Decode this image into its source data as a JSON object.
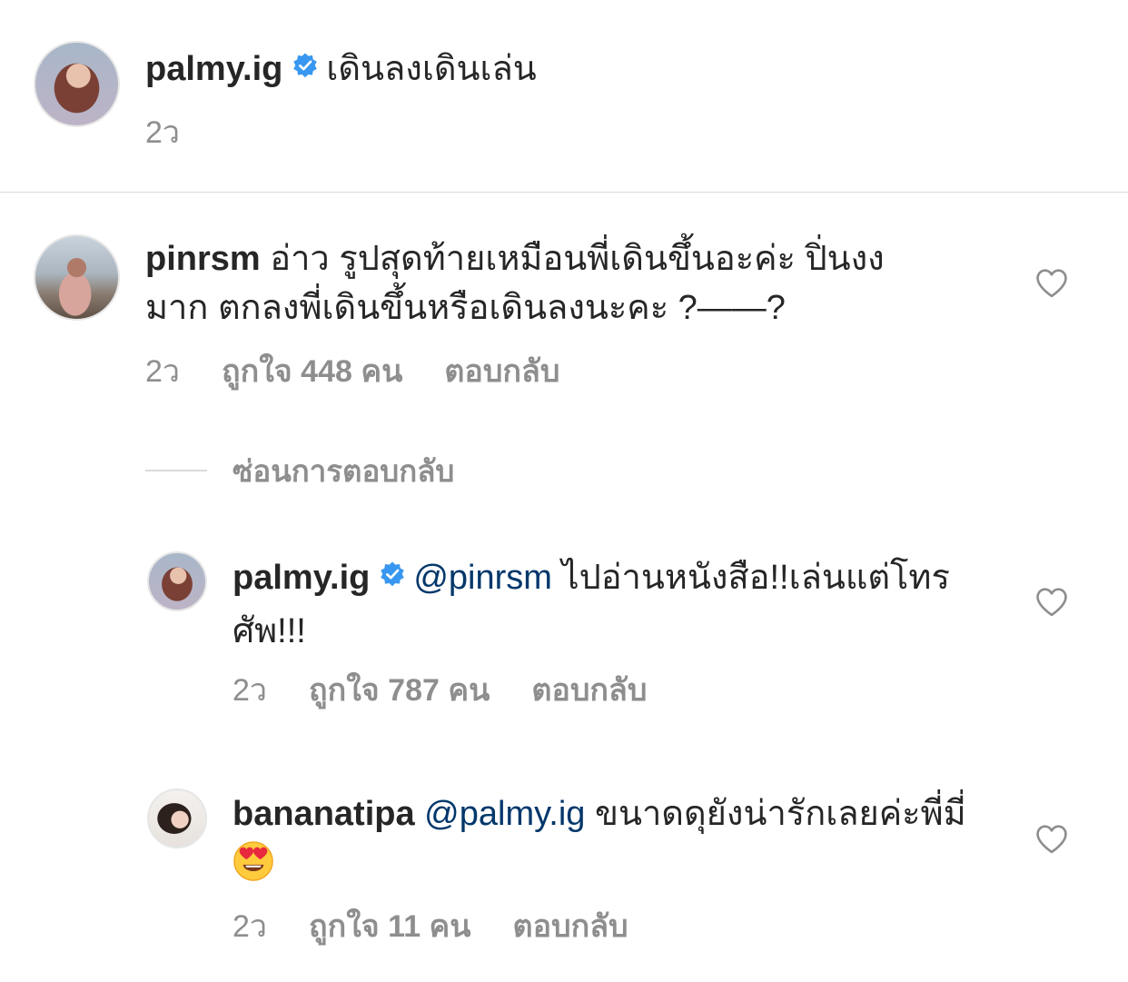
{
  "caption": {
    "username": "palmy.ig",
    "text": "เดินลงเดินเล่น",
    "time": "2ว"
  },
  "comments": [
    {
      "username": "pinrsm",
      "text": "อ่าว รูปสุดท้ายเหมือนพี่เดินขึ้นอะค่ะ ปิ่นงงมาก ตกลงพี่เดินขึ้นหรือเดินลงนะคะ ?——?",
      "time": "2ว",
      "likes": "ถูกใจ 448 คน",
      "reply": "ตอบกลับ"
    }
  ],
  "hide_replies_label": "ซ่อนการตอบกลับ",
  "replies": [
    {
      "username": "palmy.ig",
      "mention": "@pinrsm",
      "text": "ไปอ่านหนังสือ!!เล่นแต่โทรศัพ!!!",
      "time": "2ว",
      "likes": "ถูกใจ 787 คน",
      "reply": "ตอบกลับ"
    },
    {
      "username": "bananatipa",
      "mention": "@palmy.ig",
      "text": "ขนาดดุยังน่ารักเลยค่ะพี่มี่",
      "emoji": "heart-eyes-emoji",
      "time": "2ว",
      "likes": "ถูกใจ 11 คน",
      "reply": "ตอบกลับ"
    }
  ],
  "colors": {
    "text": "#262626",
    "secondary": "#8e8e8e",
    "mention": "#00376b",
    "verified": "#3897f0",
    "divider": "#dbdbdb"
  }
}
